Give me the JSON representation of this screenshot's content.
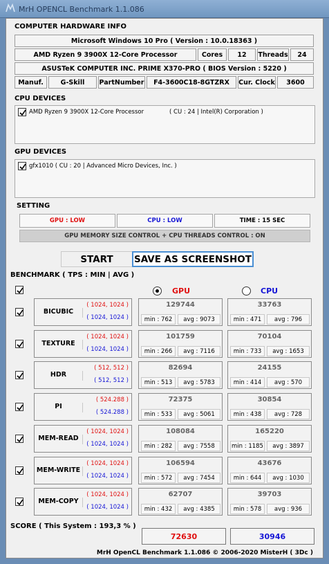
{
  "window": {
    "title": "MrH OPENCL Benchmark 1.1.086"
  },
  "hardware": {
    "section_title": "COMPUTER HARDWARE INFO",
    "os": "Microsoft Windows 10 Pro ( Version : 10.0.18363 )",
    "cpu": "AMD Ryzen 9 3900X 12-Core Processor",
    "cores_label": "Cores",
    "cores_value": "12",
    "threads_label": "Threads",
    "threads_value": "24",
    "board": "ASUSTeK COMPUTER INC. PRIME X370-PRO ( BIOS Version : 5220 )",
    "manuf_label": "Manuf.",
    "manuf_value": "G-Skill",
    "part_label": "PartNumber",
    "part_value": "F4-3600C18-8GTZRX",
    "clock_label": "Cur. Clock",
    "clock_value": "3600"
  },
  "cpu_devices": {
    "section_title": "CPU DEVICES",
    "items": [
      {
        "name": "AMD Ryzen 9 3900X 12-Core Processor",
        "info": "( CU : 24 | Intel(R) Corporation )"
      }
    ]
  },
  "gpu_devices": {
    "section_title": "GPU DEVICES",
    "items": [
      {
        "name": "gfx1010 ( CU : 20 | Advanced Micro Devices, Inc. )"
      }
    ]
  },
  "setting": {
    "section_title": "SETTING",
    "gpu": "GPU : LOW",
    "cpu": "CPU : LOW",
    "time": "TIME : 15 SEC",
    "control": "GPU MEMORY SIZE CONTROL + CPU THREADS CONTROL : ON"
  },
  "buttons": {
    "start": "START",
    "screenshot": "SAVE AS SCREENSHOT"
  },
  "benchmark": {
    "section_title": "BENCHMARK ( TPS : MIN | AVG )",
    "gpu_label": "GPU",
    "cpu_label": "CPU",
    "rows": [
      {
        "name": "BICUBIC",
        "gpu_res": "( 1024, 1024 )",
        "cpu_res": "( 1024, 1024 )",
        "gpu_score": "129744",
        "gpu_min": "min : 762",
        "gpu_avg": "avg : 9073",
        "cpu_score": "33763",
        "cpu_min": "min : 471",
        "cpu_avg": "avg : 796"
      },
      {
        "name": "TEXTURE",
        "gpu_res": "( 1024, 1024 )",
        "cpu_res": "( 1024, 1024 )",
        "gpu_score": "101759",
        "gpu_min": "min : 266",
        "gpu_avg": "avg : 7116",
        "cpu_score": "70104",
        "cpu_min": "min : 733",
        "cpu_avg": "avg : 1653"
      },
      {
        "name": "HDR",
        "gpu_res": "( 512, 512 )",
        "cpu_res": "( 512, 512 )",
        "gpu_score": "82694",
        "gpu_min": "min : 513",
        "gpu_avg": "avg : 5783",
        "cpu_score": "24155",
        "cpu_min": "min : 414",
        "cpu_avg": "avg : 570"
      },
      {
        "name": "PI",
        "gpu_res": "( 524.288 )",
        "cpu_res": "( 524.288 )",
        "gpu_score": "72375",
        "gpu_min": "min : 533",
        "gpu_avg": "avg : 5061",
        "cpu_score": "30854",
        "cpu_min": "min : 438",
        "cpu_avg": "avg : 728"
      },
      {
        "name": "MEM-READ",
        "gpu_res": "( 1024, 1024 )",
        "cpu_res": "( 1024, 1024 )",
        "gpu_score": "108084",
        "gpu_min": "min : 282",
        "gpu_avg": "avg : 7558",
        "cpu_score": "165220",
        "cpu_min": "min : 1185",
        "cpu_avg": "avg : 3897"
      },
      {
        "name": "MEM-WRITE",
        "gpu_res": "( 1024, 1024 )",
        "cpu_res": "( 1024, 1024 )",
        "gpu_score": "106594",
        "gpu_min": "min : 572",
        "gpu_avg": "avg : 7454",
        "cpu_score": "43676",
        "cpu_min": "min : 644",
        "cpu_avg": "avg : 1030"
      },
      {
        "name": "MEM-COPY",
        "gpu_res": "( 1024, 1024 )",
        "cpu_res": "( 1024, 1024 )",
        "gpu_score": "62707",
        "gpu_min": "min : 432",
        "gpu_avg": "avg : 4385",
        "cpu_score": "39703",
        "cpu_min": "min : 578",
        "cpu_avg": "avg : 936"
      }
    ]
  },
  "score": {
    "label": "SCORE ( This System : 193,3 % )",
    "gpu_total": "72630",
    "cpu_total": "30946"
  },
  "footer": "MrH OpenCL Benchmark 1.1.086  ©  2006-2020 MisterH ( 3Dc )",
  "colors": {
    "gpu": "#e01010",
    "cpu": "#1515d6",
    "title_bar": "#7fa3cb",
    "screenshot_border": "#4a8fd4"
  }
}
